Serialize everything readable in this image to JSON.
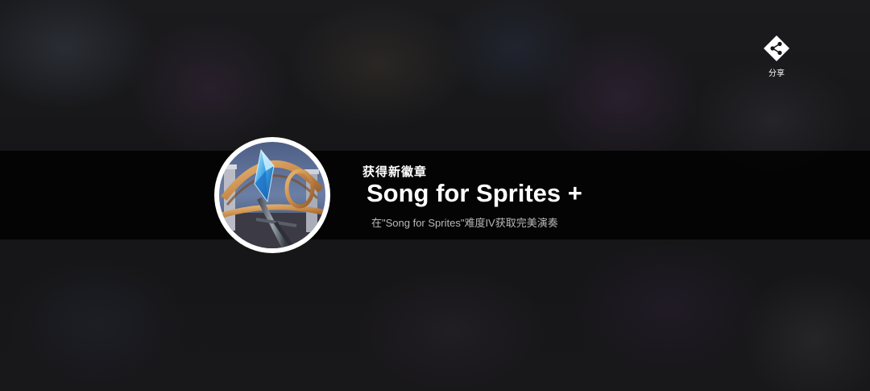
{
  "share": {
    "label": "分享",
    "icon": "share-icon"
  },
  "badge": {
    "heading": "获得新徽章",
    "name": "Song for Sprites +",
    "description": "在\"Song for Sprites\"难度IV获取完美演奏",
    "image": "crystal-staff-badge"
  },
  "colors": {
    "band": "#000000",
    "text_primary": "#ffffff",
    "text_secondary": "#b9b9b9",
    "badge_border": "#ffffff",
    "crystal": "#3fa6e8"
  }
}
